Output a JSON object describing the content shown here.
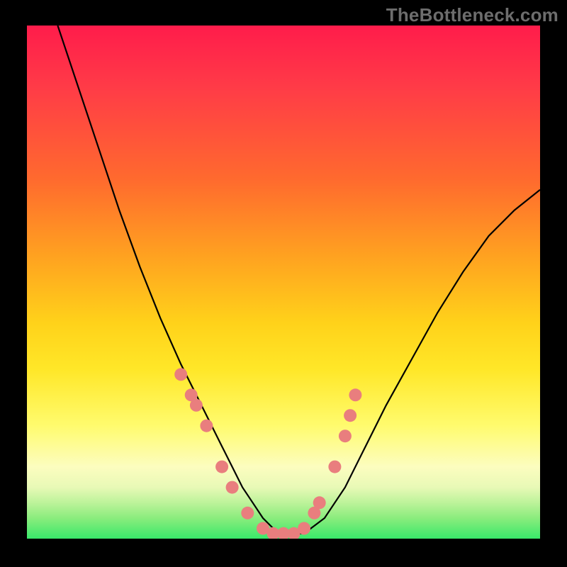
{
  "watermark": "TheBottleneck.com",
  "chart_data": {
    "type": "line",
    "title": "",
    "xlabel": "",
    "ylabel": "",
    "xlim": [
      0,
      100
    ],
    "ylim": [
      0,
      100
    ],
    "background_gradient": {
      "orientation": "vertical",
      "stops": [
        {
          "pct": 0,
          "color": "#ff1c4b"
        },
        {
          "pct": 12,
          "color": "#ff3b47"
        },
        {
          "pct": 30,
          "color": "#ff6a2e"
        },
        {
          "pct": 45,
          "color": "#ffa220"
        },
        {
          "pct": 58,
          "color": "#ffd21a"
        },
        {
          "pct": 67,
          "color": "#ffe728"
        },
        {
          "pct": 78,
          "color": "#fffb6e"
        },
        {
          "pct": 86,
          "color": "#fcfdbf"
        },
        {
          "pct": 90,
          "color": "#e8f9b6"
        },
        {
          "pct": 93,
          "color": "#bdf39a"
        },
        {
          "pct": 96,
          "color": "#8aec7d"
        },
        {
          "pct": 100,
          "color": "#39e96a"
        }
      ]
    },
    "series": [
      {
        "name": "curve",
        "type": "line",
        "x": [
          6,
          10,
          14,
          18,
          22,
          26,
          30,
          34,
          38,
          40,
          42,
          44,
          46,
          48,
          50,
          54,
          58,
          62,
          66,
          70,
          75,
          80,
          85,
          90,
          95,
          100
        ],
        "y": [
          100,
          88,
          76,
          64,
          53,
          43,
          34,
          26,
          18,
          14,
          10,
          7,
          4,
          2,
          1,
          1,
          4,
          10,
          18,
          26,
          35,
          44,
          52,
          59,
          64,
          68
        ]
      },
      {
        "name": "markers",
        "type": "scatter",
        "x": [
          30,
          32,
          33,
          35,
          38,
          40,
          43,
          46,
          48,
          50,
          52,
          54,
          56,
          57,
          60,
          62,
          63,
          64
        ],
        "y": [
          32,
          28,
          26,
          22,
          14,
          10,
          5,
          2,
          1,
          1,
          1,
          2,
          5,
          7,
          14,
          20,
          24,
          28
        ],
        "color": "#e97e7e"
      }
    ]
  }
}
